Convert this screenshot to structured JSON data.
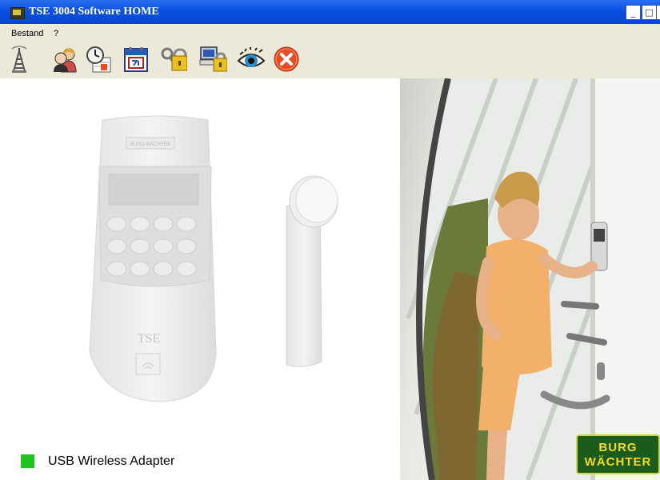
{
  "window": {
    "title": "TSE 3004 Software HOME",
    "btn_min": "_",
    "btn_max": "□",
    "btn_close": "×"
  },
  "menu": [
    {
      "label": "Bestand"
    },
    {
      "label": "?"
    }
  ],
  "toolbar_icons": [
    "antenna-icon",
    "users-icon",
    "clock-schedule-icon",
    "calendar-icon",
    "key-lock-icon",
    "computer-lock-icon",
    "eye-icon",
    "exit-icon"
  ],
  "product_art": {
    "keypad_brand": "BURG-WÄCHTER",
    "keypad_logo": "TSE"
  },
  "status": {
    "label": "USB Wireless Adapter",
    "color": "#20c420"
  },
  "brand_logo": {
    "line1": "BURG",
    "line2": "WÄCHTER"
  }
}
